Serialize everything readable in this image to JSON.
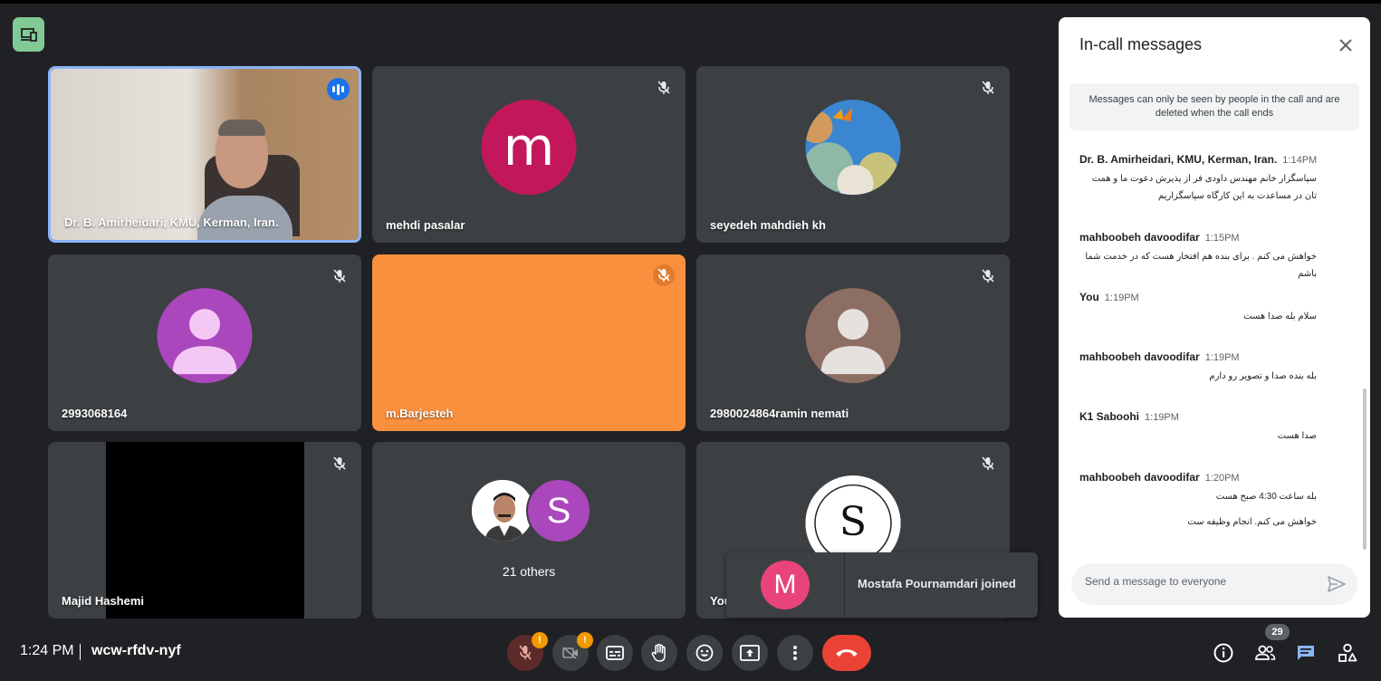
{
  "meeting": {
    "time": "1:24 PM",
    "code": "wcw-rfdv-nyf",
    "participant_count": "29"
  },
  "tiles": [
    {
      "name": "Dr. B. Amirheidari, KMU, Kerman, Iran."
    },
    {
      "name": "mehdi pasalar",
      "avatar_letter": "m",
      "avatar_color": "#c2185b"
    },
    {
      "name": "seyedeh mahdieh kh"
    },
    {
      "name": "2993068164"
    },
    {
      "name": "m.Barjesteh",
      "bg_color": "#fa903e"
    },
    {
      "name": "2980024864ramin nemati"
    },
    {
      "name": "Majid Hashemi"
    },
    {
      "others_label": "21 others",
      "avatar_letter": "S"
    },
    {
      "name": "You"
    }
  ],
  "toast": {
    "avatar_letter": "M",
    "text": "Mostafa Pournamdari joined"
  },
  "chat": {
    "title": "In-call messages",
    "notice": "Messages can only be seen by people in the call and are deleted when the call ends",
    "input_placeholder": "Send a message to everyone",
    "messages": [
      {
        "sender": "Dr. B. Amirheidari, KMU, Kerman, Iran.",
        "time": "1:14PM",
        "text": "سپاسگزار خانم مهندس داودی فر از پذیرش دعوت ما و همت تان در مساعدت به این کارگاه سپاسگزاریم"
      },
      {
        "sender": "mahboobeh davoodifar",
        "time": "1:15PM",
        "text": "خواهش می کنم . برای بنده هم افتخار هست که در خدمت شما باشم"
      },
      {
        "sender": "You",
        "time": "1:19PM",
        "text": "سلام بله صدا هست"
      },
      {
        "sender": "mahboobeh davoodifar",
        "time": "1:19PM",
        "text": "بله بنده صدا و تصویر رو دارم"
      },
      {
        "sender": "K1 Saboohi",
        "time": "1:19PM",
        "text": "صدا هست"
      },
      {
        "sender": "mahboobeh davoodifar",
        "time": "1:20PM",
        "text": "بله ساعت 4:30 صبح هست",
        "text2": "خواهش می کنم. انجام وظیفه ست"
      }
    ]
  }
}
